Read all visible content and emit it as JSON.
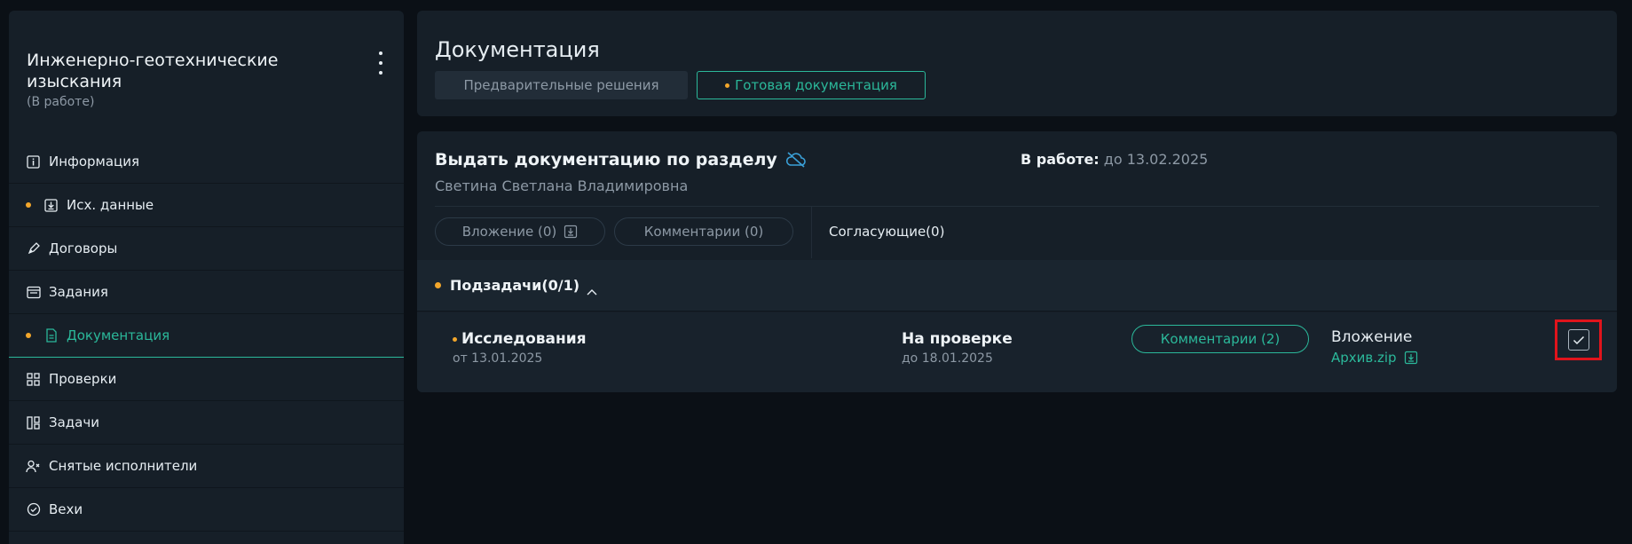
{
  "sidebar": {
    "title": "Инженерно-геотехнические изыскания",
    "status": "(В работе)",
    "items": [
      {
        "label": "Информация",
        "icon": "info-icon"
      },
      {
        "label": "Исх. данные",
        "icon": "download-icon"
      },
      {
        "label": "Договоры",
        "icon": "pen-icon"
      },
      {
        "label": "Задания",
        "icon": "window-icon"
      },
      {
        "label": "Документация",
        "icon": "document-icon"
      },
      {
        "label": "Проверки",
        "icon": "grid-icon"
      },
      {
        "label": "Задачи",
        "icon": "board-icon"
      },
      {
        "label": "Снятые исполнители",
        "icon": "user-remove-icon"
      },
      {
        "label": "Вехи",
        "icon": "check-circle-icon"
      }
    ]
  },
  "header": {
    "title": "Документация",
    "tabs": [
      "Предварительные решения",
      "Готовая документация"
    ]
  },
  "task": {
    "title": "Выдать документацию по разделу",
    "owner": "Светина Светлана Владимировна",
    "in_work_label": "В работе:",
    "in_work_value": " до 13.02.2025",
    "attachment_btn": "Вложение (0)",
    "comments_btn": "Комментарии (0)",
    "approvers": "Согласующие(0)"
  },
  "subtasks": {
    "label": "Подзадачи(0/1)",
    "rows": [
      {
        "name": "Исследования",
        "date": "от 13.01.2025",
        "status": "На проверке",
        "due": "до 18.01.2025",
        "comments": "Комментарии (2)",
        "attachment_label": "Вложение",
        "attachment_file": "Архив.zip"
      }
    ]
  },
  "colors": {
    "accent": "#2bb89a",
    "warning_dot": "#f2a62b",
    "highlight": "#e0141c"
  }
}
